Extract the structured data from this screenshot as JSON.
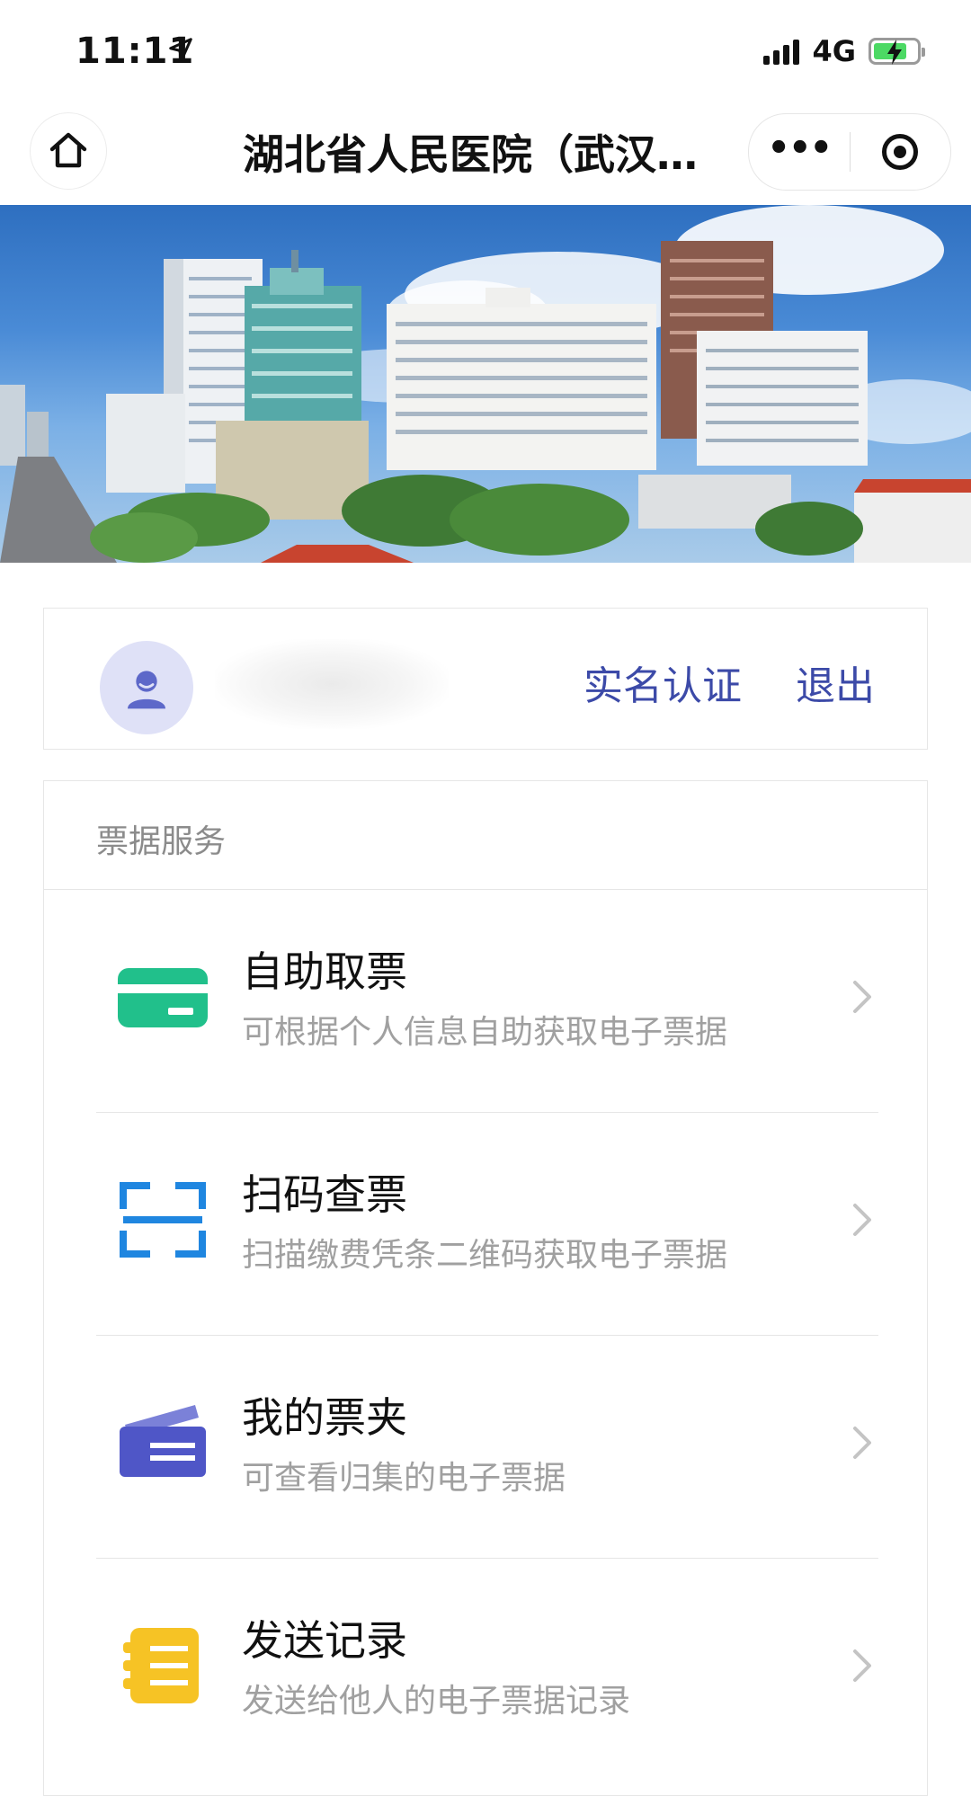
{
  "status_bar": {
    "time": "11:11",
    "network": "4G",
    "icons": [
      "location-arrow-icon",
      "signal-icon",
      "battery-charging-icon"
    ]
  },
  "nav": {
    "title": "湖北省人民医院（武汉…",
    "icons": [
      "home-icon",
      "more-dots-icon",
      "close-target-icon"
    ]
  },
  "user": {
    "verify_label": "实名认证",
    "logout_label": "退出"
  },
  "panel": {
    "title": "票据服务",
    "items": [
      {
        "title": "自助取票",
        "desc": "可根据个人信息自助获取电子票据",
        "icon": "ticket-card-icon",
        "color": "#21c08b"
      },
      {
        "title": "扫码查票",
        "desc": "扫描缴费凭条二维码获取电子票据",
        "icon": "scan-frame-icon",
        "color": "#1f86e0"
      },
      {
        "title": "我的票夹",
        "desc": "可查看归集的电子票据",
        "icon": "ticket-folder-icon",
        "color": "#4f56c7"
      },
      {
        "title": "发送记录",
        "desc": "发送给他人的电子票据记录",
        "icon": "send-record-icon",
        "color": "#f6c325"
      }
    ]
  },
  "colors": {
    "link": "#3c4aa8",
    "muted_text": "#a0a0a0",
    "border": "#e6e6e6"
  }
}
